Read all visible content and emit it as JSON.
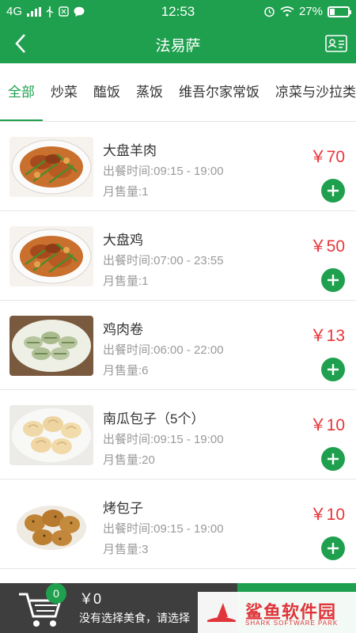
{
  "status_bar": {
    "network": "4G",
    "time": "12:53",
    "battery_percent": "27%",
    "battery_level": 0.27
  },
  "header": {
    "title": "法易萨"
  },
  "tabs": [
    {
      "label": "全部",
      "active": true
    },
    {
      "label": "炒菜",
      "active": false
    },
    {
      "label": "醢饭",
      "active": false
    },
    {
      "label": "蒸饭",
      "active": false
    },
    {
      "label": "维吾尔家常饭",
      "active": false
    },
    {
      "label": "凉菜与沙拉类",
      "active": false
    }
  ],
  "dishes": [
    {
      "name": "大盘羊肉",
      "time": "出餐时间:09:15 - 19:00",
      "sold": "月售量:1",
      "price": "￥70",
      "image": "roast-lamb-plate"
    },
    {
      "name": "大盘鸡",
      "time": "出餐时间:07:00 - 23:55",
      "sold": "月售量:1",
      "price": "￥50",
      "image": "roast-lamb-plate"
    },
    {
      "name": "鸡肉卷",
      "time": "出餐时间:06:00 - 22:00",
      "sold": "月售量:6",
      "price": "￥13",
      "image": "rolls-plate"
    },
    {
      "name": "南瓜包子（5个）",
      "time": "出餐时间:09:15 - 19:00",
      "sold": "月售量:20",
      "price": "￥10",
      "image": "dumplings-plate"
    },
    {
      "name": "烤包子",
      "time": "出餐时间:09:15 - 19:00",
      "sold": "月售量:3",
      "price": "￥10",
      "image": "baked-buns-plate"
    }
  ],
  "cart": {
    "count": "0",
    "total": "￥0",
    "hint": "没有选择美食，请选择"
  },
  "watermark": {
    "brand": "鲨鱼软件园",
    "sub": "SHARK SOFTWARE PARK"
  },
  "colors": {
    "primary": "#1fa04e",
    "price": "#e8353a",
    "cartbar": "#3e3e3e"
  }
}
